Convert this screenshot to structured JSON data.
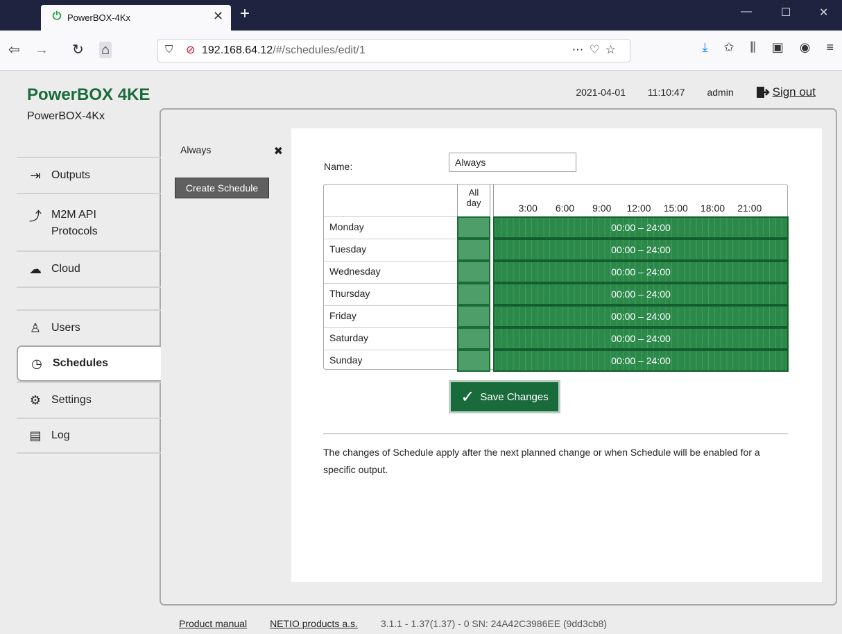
{
  "browser": {
    "tab_title": "PowerBOX-4Kx",
    "url_host": "192.168.64.12",
    "url_path": "/#/schedules/edit/1"
  },
  "header": {
    "brand": "PowerBOX 4KE",
    "device_name": "PowerBOX-4Kx",
    "date": "2021-04-01",
    "time": "11:10:47",
    "user": "admin",
    "sign_out": "Sign out"
  },
  "nav": {
    "outputs": "Outputs",
    "m2m_line1": "M2M API",
    "m2m_line2": "Protocols",
    "cloud": "Cloud",
    "users": "Users",
    "schedules": "Schedules",
    "settings": "Settings",
    "log": "Log"
  },
  "schedules": {
    "list": [
      {
        "name": "Always"
      }
    ],
    "create_button": "Create Schedule"
  },
  "editor": {
    "name_label": "Name:",
    "name_value": "Always",
    "allday_header_line1": "All",
    "allday_header_line2": "day",
    "hour_labels": [
      "3:00",
      "6:00",
      "9:00",
      "12:00",
      "15:00",
      "18:00",
      "21:00"
    ],
    "days": [
      {
        "day": "Monday",
        "range": "00:00 – 24:00"
      },
      {
        "day": "Tuesday",
        "range": "00:00 – 24:00"
      },
      {
        "day": "Wednesday",
        "range": "00:00 – 24:00"
      },
      {
        "day": "Thursday",
        "range": "00:00 – 24:00"
      },
      {
        "day": "Friday",
        "range": "00:00 – 24:00"
      },
      {
        "day": "Saturday",
        "range": "00:00 – 24:00"
      },
      {
        "day": "Sunday",
        "range": "00:00 – 24:00"
      }
    ],
    "save_button": "Save Changes",
    "note": "The changes of Schedule apply after the next planned change or when Schedule will be enabled for a specific output."
  },
  "footer": {
    "manual": "Product manual",
    "company": "NETIO products a.s.",
    "version": "3.1.1 - 1.37(1.37) - 0 SN: 24A42C3986EE (9dd3cb8)"
  },
  "colors": {
    "brand": "#1a6b3c",
    "schedule_bar": "#2b8a4a",
    "save_button": "#1a6b3c"
  }
}
